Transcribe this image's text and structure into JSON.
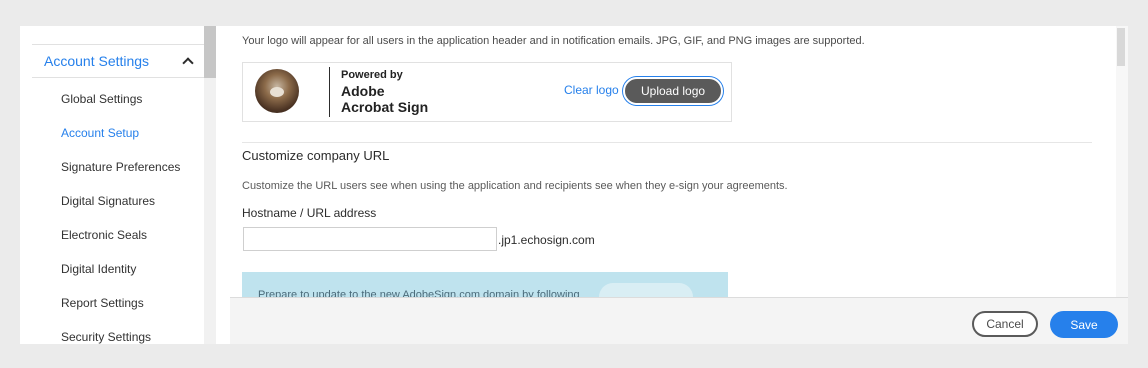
{
  "sidebar": {
    "section_title": "Account Settings",
    "items": [
      {
        "label": "Global Settings",
        "active": false
      },
      {
        "label": "Account Setup",
        "active": true
      },
      {
        "label": "Signature Preferences",
        "active": false
      },
      {
        "label": "Digital Signatures",
        "active": false
      },
      {
        "label": "Electronic Seals",
        "active": false
      },
      {
        "label": "Digital Identity",
        "active": false
      },
      {
        "label": "Report Settings",
        "active": false
      },
      {
        "label": "Security Settings",
        "active": false
      }
    ]
  },
  "logo_section": {
    "description": "Your logo will appear for all users in the application header and in notification emails. JPG, GIF, and PNG images are supported.",
    "powered_by": "Powered by",
    "brand_line1": "Adobe",
    "brand_line2": "Acrobat Sign",
    "clear_label": "Clear logo",
    "upload_label": "Upload logo"
  },
  "url_section": {
    "title": "Customize company URL",
    "description": "Customize the URL users see when using the application and recipients see when they e-sign your agreements.",
    "hostname_label": "Hostname / URL address",
    "hostname_value": "",
    "hostname_suffix": ".jp1.echosign.com"
  },
  "banner": {
    "text": "Prepare to update to the new AdobeSign.com domain by following"
  },
  "footer": {
    "cancel_label": "Cancel",
    "save_label": "Save"
  },
  "colors": {
    "accent": "#2680eb",
    "banner_bg": "#bfe3ee",
    "upload_button": "#5a5a5a"
  },
  "icons": {
    "collapse": "chevron-up-icon",
    "logo": "dog-avatar"
  }
}
